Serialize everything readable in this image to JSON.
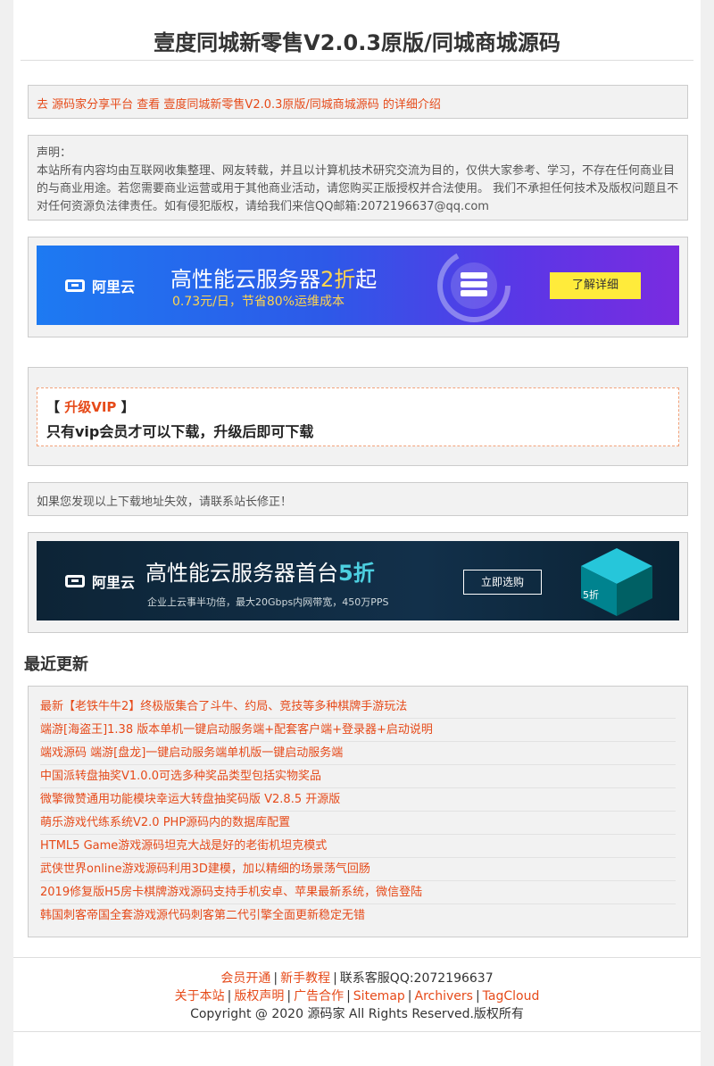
{
  "header": {
    "title": "壹度同城新零售V2.0.3原版/同城商城源码"
  },
  "intro": {
    "prefix": "去 ",
    "site_link": "源码家分享平台",
    "middle": " 查看 ",
    "item_link": "壹度同城新零售V2.0.3原版/同城商城源码",
    "suffix": " 的详细介绍"
  },
  "notice": {
    "heading": "声明：",
    "body": "本站所有内容均由互联网收集整理、网友转载，并且以计算机技术研究交流为目的，仅供大家参考、学习，不存在任何商业目的与商业用途。若您需要商业运营或用于其他商业活动，请您购买正版授权并合法使用。 我们不承担任何技术及版权问题且不对任何资源负法律责任。如有侵犯版权，请给我们来信QQ邮箱:2072196637@qq.com"
  },
  "ad_banner_1": {
    "logo": "阿里云",
    "headline_a": "高性能云服务器",
    "headline_hl": "2折",
    "headline_b": "起",
    "subline_a": "0.73元/日，节省",
    "subline_hl": "80%",
    "subline_b": "运维成本",
    "button": "了解详细"
  },
  "vip": {
    "bracket_open": "【 ",
    "label": "升级VIP",
    "bracket_close": " 】",
    "message": "只有vip会员才可以下载，升级后即可下载"
  },
  "fix_notice": "如果您发现以上下载地址失效，请联系站长修正！",
  "ad_banner_2": {
    "logo": "阿里云",
    "headline_a": "高性能云服务器首台",
    "headline_hl": "5折",
    "subline": "企业上云事半功倍，最大20Gbps内网带宽，450万PPS",
    "button": "立即选购",
    "badge": "5折"
  },
  "recent": {
    "title": "最近更新",
    "items": [
      "最新【老铁牛牛2】终极版集合了斗牛、约局、竞技等多种棋牌手游玩法",
      "端游[海盗王]1.38 版本单机一键启动服务端+配套客户端+登录器+启动说明",
      "端戏源码 端游[盘龙]一键启动服务端单机版一键启动服务端",
      "中国派转盘抽奖V1.0.0可选多种奖品类型包括实物奖品",
      "微擎微赞通用功能模块幸运大转盘抽奖码版 V2.8.5 开源版",
      "萌乐游戏代练系统V2.0 PHP源码内的数据库配置",
      "HTML5 Game游戏源码坦克大战是好的老街机坦克模式",
      "武侠世界online游戏源码利用3D建模，加以精细的场景荡气回肠",
      "2019修复版H5房卡棋牌游戏源码支持手机安卓、苹果最新系统，微信登陆",
      "韩国刺客帝国全套游戏源代码刺客第二代引擎全面更新稳定无错"
    ]
  },
  "footer": {
    "line1": {
      "member": "会员开通",
      "tutorial": "新手教程",
      "service": "联系客服QQ:2072196637"
    },
    "line2": {
      "about": "关于本站",
      "copyright": "版权声明",
      "ads": "广告合作",
      "sitemap": "Sitemap",
      "archivers": "Archivers",
      "tagcloud": "TagCloud"
    },
    "line3": "Copyright @ 2020 源码家 All Rights Reserved.版权所有"
  },
  "colors": {
    "accent": "#e64a19",
    "panel": "#f2f2f2",
    "border": "#cccccc"
  }
}
